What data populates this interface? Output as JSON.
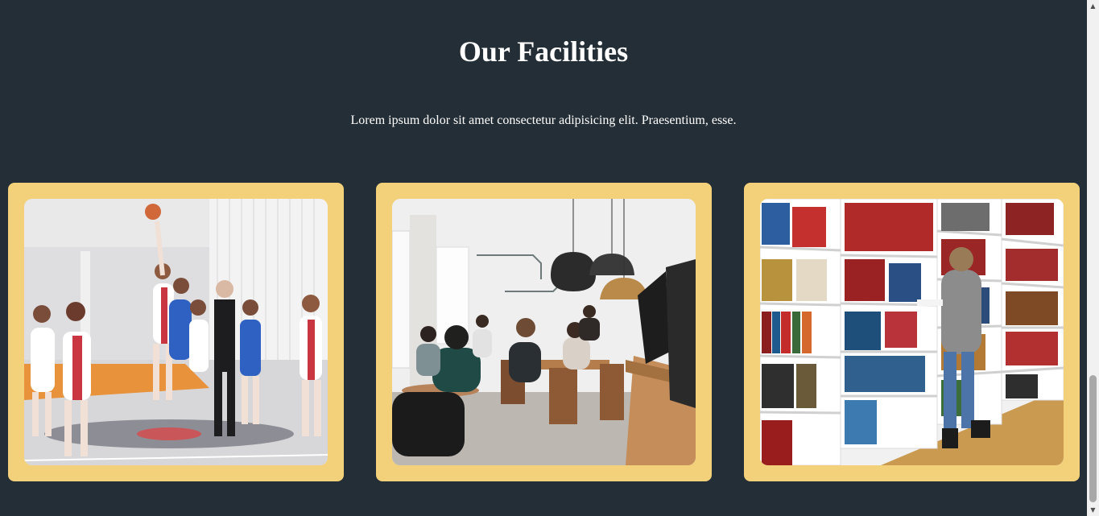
{
  "section": {
    "title": "Our Facilities",
    "subtitle": "Lorem ipsum dolor sit amet consectetur adipisicing elit. Praesentium, esse."
  },
  "cards": [
    {
      "image": "basketball-court-photo"
    },
    {
      "image": "cafeteria-photo"
    },
    {
      "image": "library-photo"
    }
  ],
  "colors": {
    "background": "#242e36",
    "card": "#f3d17a",
    "text": "#ffffff"
  },
  "icons": {
    "scroll_up": "triangle-up-icon",
    "scroll_down": "triangle-down-icon"
  }
}
